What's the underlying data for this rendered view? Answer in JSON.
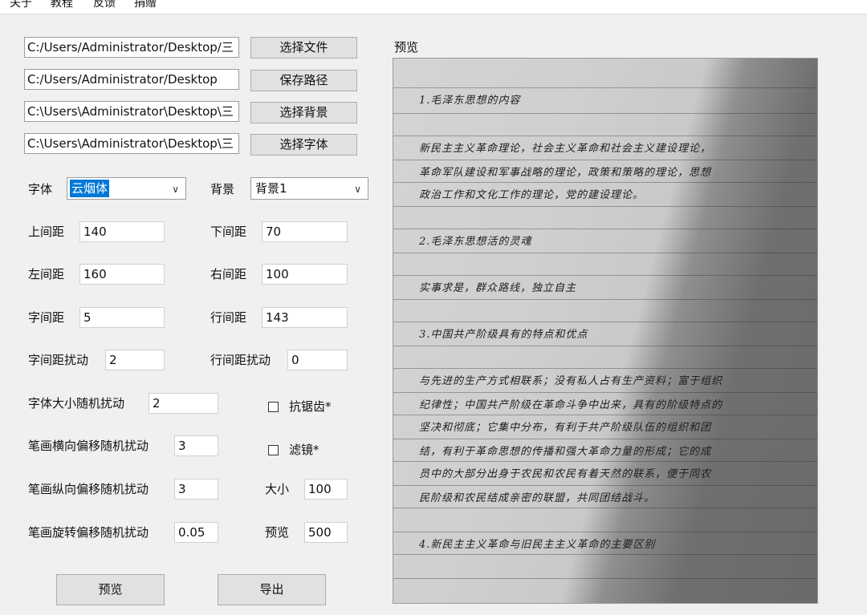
{
  "menu": [
    "关于",
    "教程",
    "反馈",
    "捐赠"
  ],
  "files": {
    "file_path": "C:/Users/Administrator/Desktop/三",
    "save_path": "C:/Users/Administrator/Desktop",
    "bg_path": "C:\\Users\\Administrator\\Desktop\\三",
    "font_path": "C:\\Users\\Administrator\\Desktop\\三",
    "select_file_label": "选择文件",
    "save_path_label": "保存路径",
    "select_bg_label": "选择背景",
    "select_font_label": "选择字体"
  },
  "font": {
    "label": "字体",
    "value": "云烟体"
  },
  "background": {
    "label": "背景",
    "value": "背景1"
  },
  "params": {
    "top_margin": {
      "label": "上间距",
      "value": "140"
    },
    "bottom_margin": {
      "label": "下间距",
      "value": "70"
    },
    "left_margin": {
      "label": "左间距",
      "value": "160"
    },
    "right_margin": {
      "label": "右间距",
      "value": "100"
    },
    "char_spacing": {
      "label": "字间距",
      "value": "5"
    },
    "line_spacing": {
      "label": "行间距",
      "value": "143"
    },
    "char_spacing_jitter": {
      "label": "字间距扰动",
      "value": "2"
    },
    "line_spacing_jitter": {
      "label": "行间距扰动",
      "value": "0"
    },
    "font_size_jitter": {
      "label": "字体大小随机扰动",
      "value": "2"
    },
    "stroke_h_jitter": {
      "label": "笔画横向偏移随机扰动",
      "value": "3"
    },
    "stroke_v_jitter": {
      "label": "笔画纵向偏移随机扰动",
      "value": "3"
    },
    "stroke_rot_jitter": {
      "label": "笔画旋转偏移随机扰动",
      "value": "0.05"
    },
    "size": {
      "label": "大小",
      "value": "100"
    },
    "preview": {
      "label": "预览",
      "value": "500"
    }
  },
  "options": {
    "antialias_label": "抗锯齿*",
    "filter_label": "滤镜*"
  },
  "buttons": {
    "preview_label": "预览",
    "export_label": "导出"
  },
  "preview": {
    "title": "预览",
    "lines": [
      "1.毛泽东思想的内容",
      "新民主主义革命理论，社会主义革命和社会主义建设理论，",
      "革命军队建设和军事战略的理论，政策和策略的理论，思想",
      "政治工作和文化工作的理论，党的建设理论。",
      "2.毛泽东思想活的灵魂",
      "实事求是，群众路线，独立自主",
      "3.中国共产阶级具有的特点和优点",
      "与先进的生产方式相联系；没有私人占有生产资料；富于组织",
      "纪律性；中国共产阶级在革命斗争中出来，具有的阶级特点的",
      "坚决和彻底；它集中分布，有利于共产阶级队伍的组织和团",
      "结，有利于革命思想的传播和强大革命力量的形成；它的成",
      "员中的大部分出身于农民和农民有着天然的联系，便于同农",
      "民阶级和农民结成亲密的联盟，共同团结战斗。",
      "4.新民主主义革命与旧民主主义革命的主要区别"
    ]
  }
}
